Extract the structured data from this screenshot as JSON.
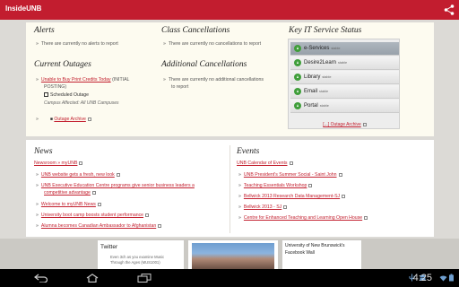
{
  "app": {
    "title": "InsideUNB"
  },
  "alerts": {
    "heading": "Alerts",
    "items": [
      "There are currently no alerts to report"
    ]
  },
  "class_cancellations": {
    "heading": "Class Cancellations",
    "items": [
      "There are currently no cancellations to report"
    ]
  },
  "current_outages": {
    "heading": "Current Outages",
    "link": "Unable to Buy Print Credits Today",
    "suffix": " (INITIAL",
    "suffix2": "POSTING)",
    "scheduled": "Scheduled Outage",
    "affected": "Campus Affected: All UNB Campuses",
    "archive": "Outage Archive"
  },
  "additional_cancellations": {
    "heading": "Additional Cancellations",
    "line1": "There are currently no additional cancellations",
    "line2": "to report"
  },
  "it_status": {
    "heading": "Key IT Service Status",
    "services": [
      {
        "name": "e-Services",
        "status": "stable"
      },
      {
        "name": "Desire2Learn",
        "status": "stable"
      },
      {
        "name": "Library",
        "status": "stable"
      },
      {
        "name": "Email",
        "status": "stable"
      },
      {
        "name": "Portal",
        "status": "stable"
      }
    ],
    "archive": "[...] Outage Archive"
  },
  "news": {
    "heading": "News",
    "source": "Newsroom » myUNB",
    "items": [
      "UNB website gets a fresh, new look",
      "UNB Executive Education Centre programs give senior business leaders a",
      "competitive advantage",
      "Welcome to myUNB News",
      "University boot camp boosts student performance",
      "Alumna becomes Canadian Ambassador to Afghanistan"
    ]
  },
  "events": {
    "heading": "Events",
    "source": "UNB Calendar of Events",
    "items": [
      "UNB President's Summer Social - Saint John",
      "Teaching Essentials Workshop",
      "Bellwick 2013 Research Data Management-SJ",
      "Bellwick 2013 - SJ",
      "Centre for Enhanced Teaching and Learning Open House"
    ]
  },
  "twitter": {
    "title": "Twitter",
    "line1": "Even 3ch as you examine Music",
    "line2": "Through the Ages (MUS1001)"
  },
  "facebook": {
    "title1": "University of New Brunswick's",
    "title2": "Facebook Wall"
  },
  "system": {
    "time": "4:25"
  }
}
